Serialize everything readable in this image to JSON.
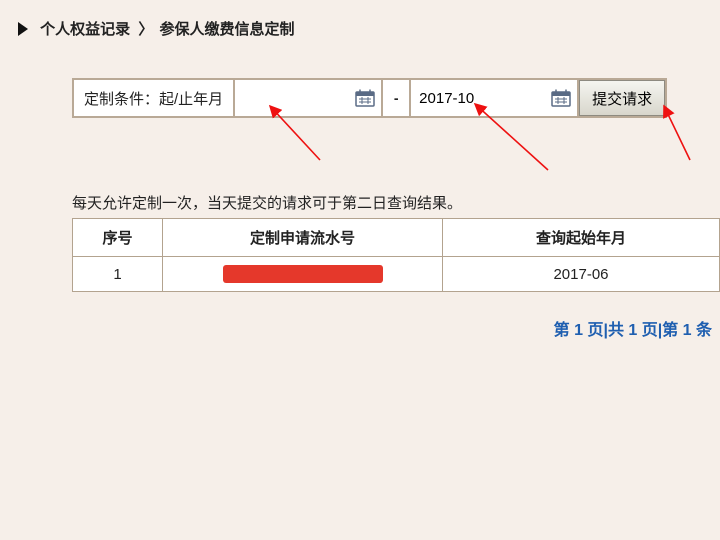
{
  "breadcrumb": {
    "section": "个人权益记录",
    "separator": "〉",
    "page": "参保人缴费信息定制"
  },
  "filter": {
    "label": "定制条件：起/止年月",
    "from_value": "",
    "dash": "-",
    "to_value": "2017-10",
    "submit_label": "提交请求"
  },
  "hint_text": "每天允许定制一次，当天提交的请求可于第二日查询结果。",
  "table": {
    "headers": [
      "序号",
      "定制申请流水号",
      "查询起始年月"
    ],
    "rows": [
      {
        "seq": "1",
        "serial_redacted": true,
        "start_month": "2017-06"
      }
    ]
  },
  "pagination": {
    "text": "第 1 页|共 1 页|第 1 条"
  }
}
